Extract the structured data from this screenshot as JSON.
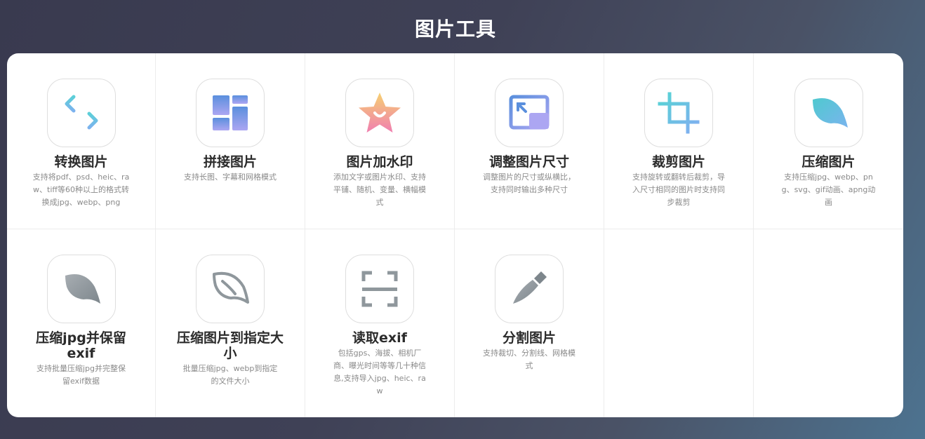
{
  "page": {
    "title": "图片工具"
  },
  "tools": [
    {
      "title": "转换图片",
      "desc": "支持将pdf、psd、heic、raw、tiff等60种以上的格式转换成jpg、webp、png",
      "icon": "swap-arrows-icon"
    },
    {
      "title": "拼接图片",
      "desc": "支持长图、字幕和网格模式",
      "icon": "grid-layout-icon"
    },
    {
      "title": "图片加水印",
      "desc": "添加文字或图片水印、支持平铺、随机、变量、横幅模式",
      "icon": "star-watermark-icon"
    },
    {
      "title": "调整图片尺寸",
      "desc": "调整图片的尺寸或纵横比，支持同时输出多种尺寸",
      "icon": "resize-icon"
    },
    {
      "title": "裁剪图片",
      "desc": "支持旋转或翻转后裁剪，导入尺寸相同的图片时支持同步裁剪",
      "icon": "crop-icon"
    },
    {
      "title": "压缩图片",
      "desc": "支持压缩jpg、webp、png、svg、gif动画、apng动画",
      "icon": "feather-icon"
    },
    {
      "title": "压缩jpg并保留exif",
      "desc": "支持批量压缩jpg并完整保留exif数据",
      "icon": "feather-solid-icon"
    },
    {
      "title": "压缩图片到指定大小",
      "desc": "批量压缩jpg、webp到指定的文件大小",
      "icon": "feather-outline-icon"
    },
    {
      "title": "读取exif",
      "desc": "包括gps、海拔、相机厂商、曝光时间等等几十种信息,支持导入jpg、heic、raw",
      "icon": "scan-icon"
    },
    {
      "title": "分割图片",
      "desc": "支持裁切、分割线、网格模式",
      "icon": "knife-icon"
    }
  ],
  "colors": {
    "teal": "#5ccfd8",
    "blue": "#6a8fe0",
    "purple": "#a9a3f0",
    "gray": "#8f979c"
  }
}
